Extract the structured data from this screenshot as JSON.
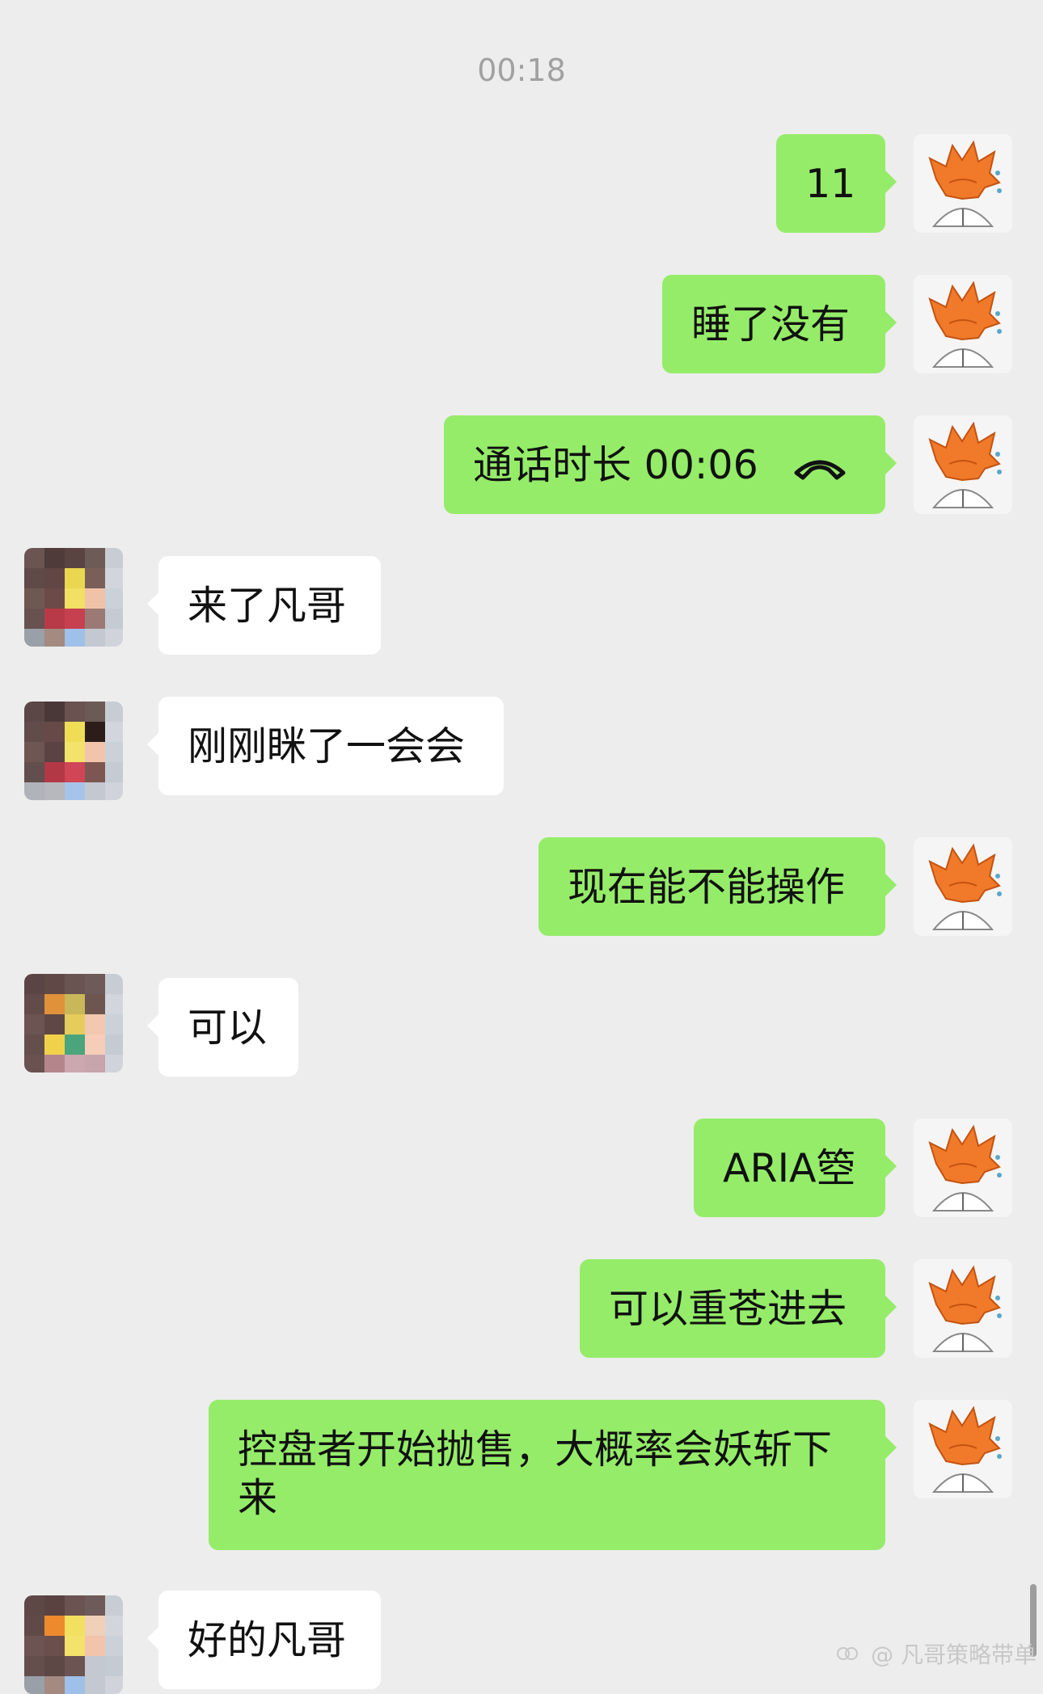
{
  "chat": {
    "timestamp": "00:18",
    "messages": [
      {
        "side": "out",
        "text": "11"
      },
      {
        "side": "out",
        "text": "睡了没有"
      },
      {
        "side": "out",
        "text": "通话时长 00:06",
        "icon": "phone-hangup-icon"
      },
      {
        "side": "in",
        "text": "来了凡哥"
      },
      {
        "side": "in",
        "text": "刚刚眯了一会会"
      },
      {
        "side": "out",
        "text": "现在能不能操作"
      },
      {
        "side": "in",
        "text": "可以"
      },
      {
        "side": "out",
        "text": "ARIA箜"
      },
      {
        "side": "out",
        "text": "可以重苍进去"
      },
      {
        "side": "out",
        "text": "控盘者开始抛售，大概率会妖斩下来"
      },
      {
        "side": "in",
        "text": "好的凡哥"
      }
    ]
  },
  "colors": {
    "background": "#ededed",
    "outgoing_bubble": "#95ec69",
    "incoming_bubble": "#ffffff"
  },
  "watermark": {
    "text": "@ 凡哥策略带单",
    "icon": "watermark-logo-icon"
  }
}
